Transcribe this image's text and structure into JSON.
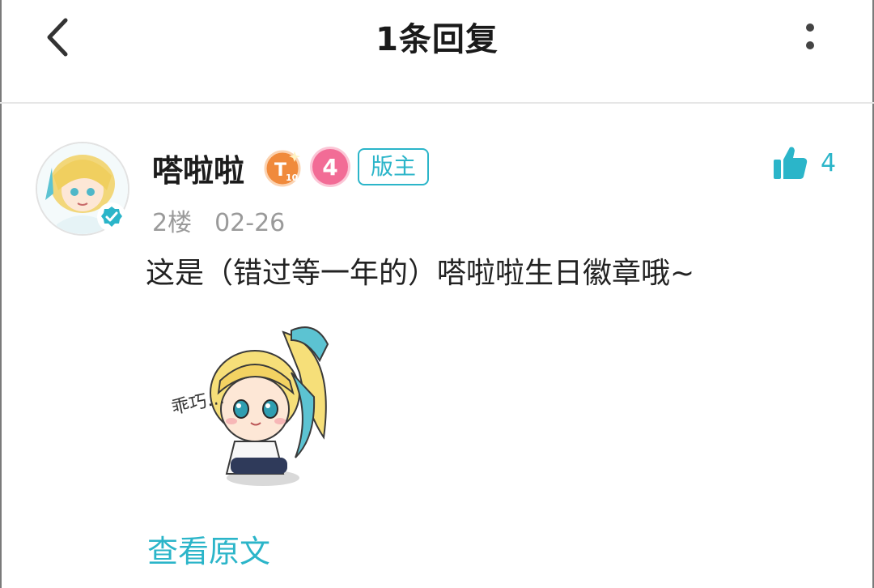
{
  "header": {
    "title": "1条回复",
    "back_icon": "chevron-left-icon",
    "more_icon": "more-vertical-icon"
  },
  "reply": {
    "username": "嗒啦啦",
    "badge_tenure": "T10",
    "badge_level": "4",
    "role": "版主",
    "floor": "2楼",
    "date": "02-26",
    "likes": "4",
    "content": "这是（错过等一年的）嗒啦啦生日徽章哦~",
    "sticker_text": "乖巧…",
    "view_original": "查看原文"
  },
  "colors": {
    "accent": "#2bb5c9",
    "level_badge": "#f26c96",
    "tenure_badge": "#f08a3c",
    "meta_text": "#9a9a9a"
  }
}
